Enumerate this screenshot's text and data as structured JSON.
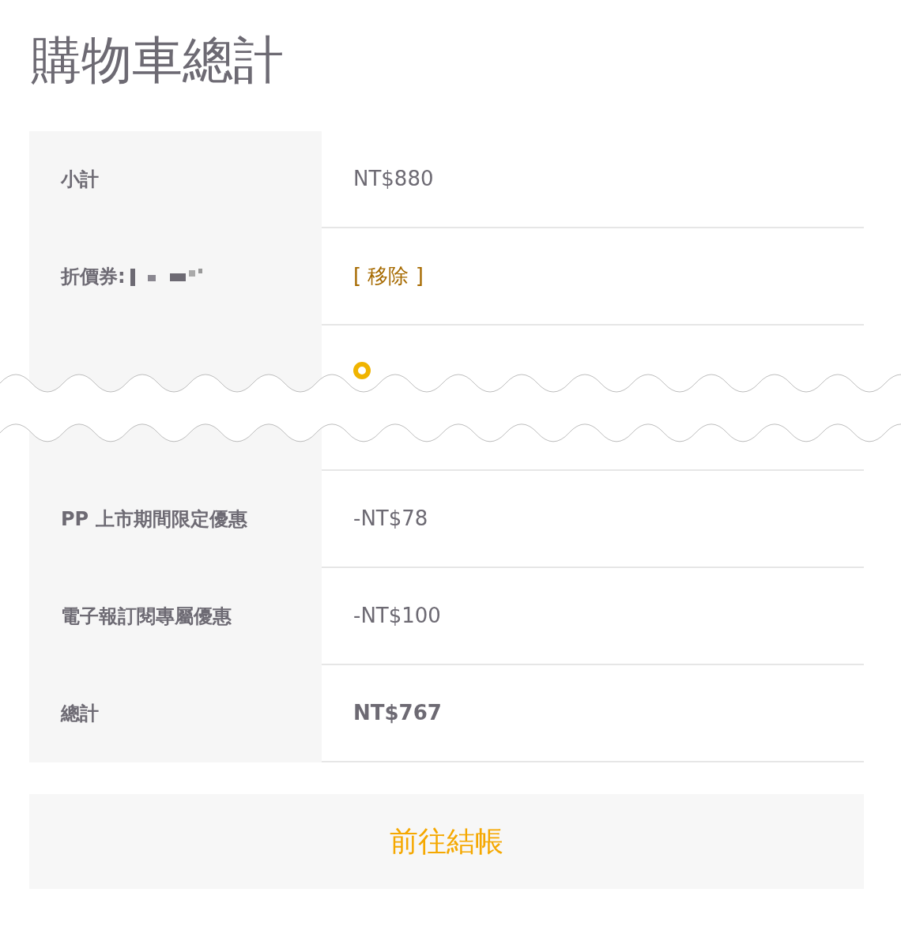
{
  "title": "購物車總計",
  "rows": [
    {
      "kind": "text",
      "label": "小計",
      "value": "NT$880"
    },
    {
      "kind": "coupon",
      "label": "折價券:",
      "action": "[ 移除 ]"
    },
    {
      "kind": "shipping",
      "options": [
        {
          "selected": true
        }
      ]
    },
    {
      "kind": "text",
      "label": "PP 上市期間限定優惠",
      "value": "-NT$78"
    },
    {
      "kind": "text",
      "label": "電子報訂閱專屬優惠",
      "value": "-NT$100"
    },
    {
      "kind": "total",
      "label": "總計",
      "value": "NT$767"
    }
  ],
  "checkout_button": "前往結帳"
}
